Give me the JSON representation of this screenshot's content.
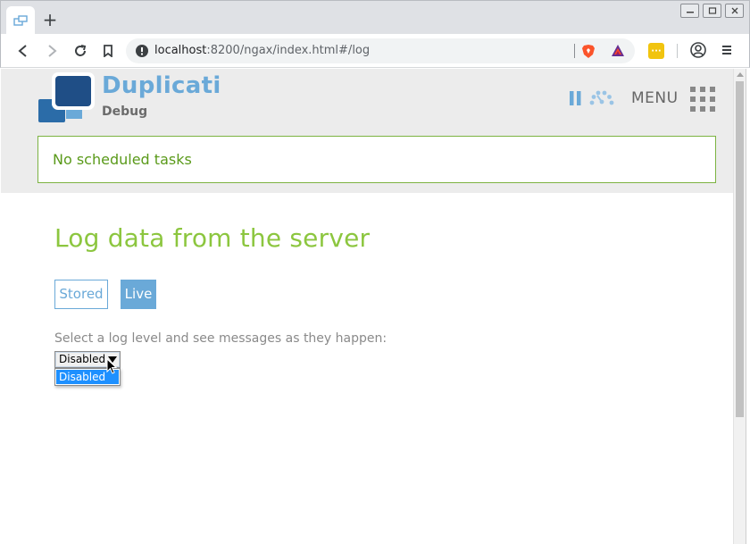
{
  "browser": {
    "tab_icon": "window-icon",
    "new_tab_label": "+",
    "url_host": "localhost",
    "url_rest": ":8200/ngax/index.html#/log"
  },
  "app": {
    "name": "Duplicati",
    "subtitle": "Debug",
    "menu_label": "MENU",
    "notice": "No scheduled tasks"
  },
  "log_page": {
    "title": "Log data from the server",
    "tabs": [
      {
        "label": "Stored",
        "active": false
      },
      {
        "label": "Live",
        "active": true
      }
    ],
    "prompt": "Select a log level and see messages as they happen:",
    "select_value": "Disabled",
    "options": [
      "Disabled"
    ]
  },
  "colors": {
    "brand_blue": "#6aa9d8",
    "title_green": "#8cc63f",
    "notice_green": "#5a9a1a",
    "select_highlight": "#1e90ff"
  }
}
